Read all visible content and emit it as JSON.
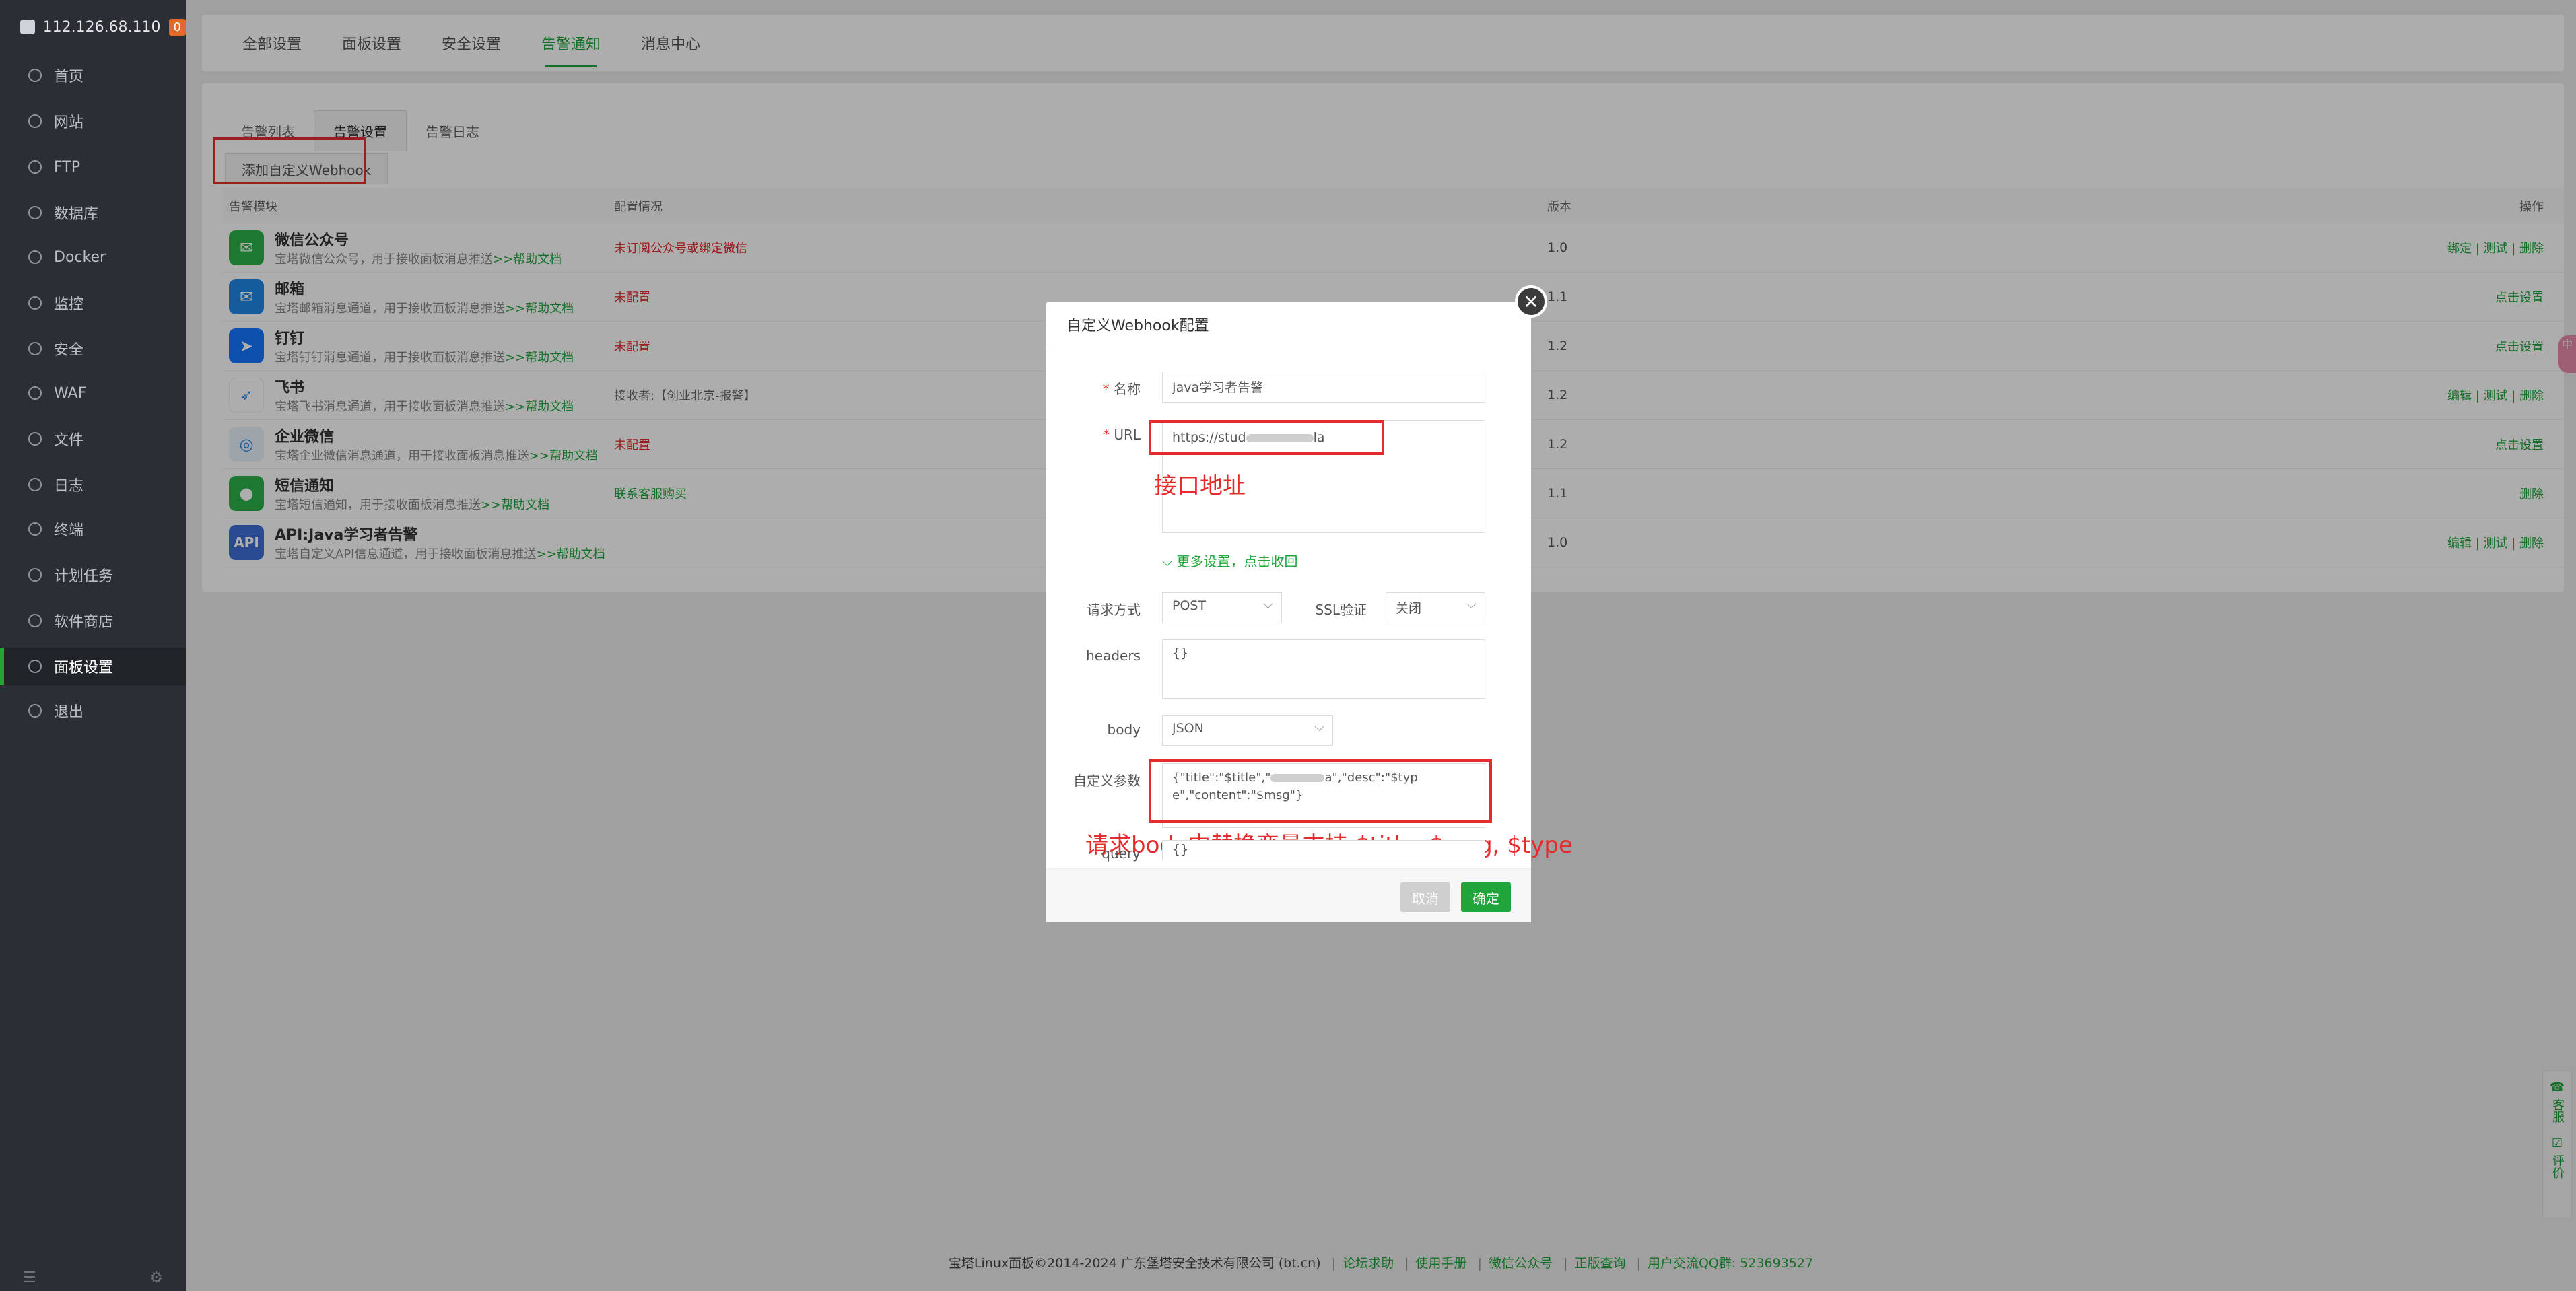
{
  "sidebar": {
    "ip": "112.126.68.110",
    "badge": "0",
    "items": [
      {
        "label": "首页"
      },
      {
        "label": "网站"
      },
      {
        "label": "FTP"
      },
      {
        "label": "数据库"
      },
      {
        "label": "Docker"
      },
      {
        "label": "监控"
      },
      {
        "label": "安全"
      },
      {
        "label": "WAF"
      },
      {
        "label": "文件"
      },
      {
        "label": "日志"
      },
      {
        "label": "终端"
      },
      {
        "label": "计划任务"
      },
      {
        "label": "软件商店"
      },
      {
        "label": "面板设置"
      },
      {
        "label": "退出"
      }
    ]
  },
  "top_tabs": [
    "全部设置",
    "面板设置",
    "安全设置",
    "告警通知",
    "消息中心"
  ],
  "sub_tabs": [
    "告警列表",
    "告警设置",
    "告警日志"
  ],
  "webhook_button": "添加自定义Webhook",
  "table": {
    "headers": [
      "告警模块",
      "配置情况",
      "版本",
      "操作"
    ],
    "rows": [
      {
        "name": "微信公众号",
        "desc": "宝塔微信公众号，用于接收面板消息推送",
        "help": ">>帮助文档",
        "status": "未订阅公众号或绑定微信",
        "version": "1.0",
        "action": "绑定 | 测试 | 删除"
      },
      {
        "name": "邮箱",
        "desc": "宝塔邮箱消息通道，用于接收面板消息推送",
        "help": ">>帮助文档",
        "status": "未配置",
        "version": "1.1",
        "action": "点击设置"
      },
      {
        "name": "钉钉",
        "desc": "宝塔钉钉消息通道，用于接收面板消息推送",
        "help": ">>帮助文档",
        "status": "未配置",
        "version": "1.2",
        "action": "点击设置"
      },
      {
        "name": "飞书",
        "desc": "宝塔飞书消息通道，用于接收面板消息推送",
        "help": ">>帮助文档",
        "status": "接收者:【创业北京-报警】",
        "version": "1.2",
        "action": "编辑 | 测试 | 删除"
      },
      {
        "name": "企业微信",
        "desc": "宝塔企业微信消息通道，用于接收面板消息推送",
        "help": ">>帮助文档",
        "status": "未配置",
        "version": "1.2",
        "action": "点击设置"
      },
      {
        "name": "短信通知",
        "desc": "宝塔短信通知，用于接收面板消息推送",
        "help": ">>帮助文档",
        "status": "联系客服购买",
        "version": "1.1",
        "action": "删除"
      },
      {
        "name": "API:Java学习者告警",
        "desc": "宝塔自定义API信息通道，用于接收面板消息推送",
        "help": ">>帮助文档",
        "status": "",
        "version": "1.0",
        "action": "编辑 | 测试 | 删除"
      }
    ]
  },
  "modal": {
    "title": "自定义Webhook配置",
    "name_label": "名称",
    "name_value": "Java学习者告警",
    "url_label": "URL",
    "url_value": "https://stud",
    "url_suffix": "la",
    "url_annotation": "接口地址",
    "more_settings": "更多设置，点击收回",
    "method_label": "请求方式",
    "method_value": "POST",
    "ssl_label": "SSL验证",
    "ssl_value": "关闭",
    "headers_label": "headers",
    "headers_value": "{}",
    "body_label": "body",
    "body_value": "JSON",
    "params_label": "自定义参数",
    "params_line1_a": "{\"title\":\"$title\",\"",
    "params_line1_b": "a\",\"desc\":\"$typ",
    "params_line2": "e\",\"content\":\"$msg\"}",
    "params_annotation": "请求body中替换变量支持 $title, $msg, $type",
    "query_label": "query",
    "query_value": "{}",
    "cancel": "取消",
    "confirm": "确定"
  },
  "footer": {
    "copyright": "宝塔Linux面板©2014-2024 广东堡塔安全技术有限公司 (bt.cn)",
    "links": [
      "论坛求助",
      "使用手册",
      "微信公众号",
      "正版查询",
      "用户交流QQ群: 523693527"
    ]
  },
  "right_float": {
    "top_tab": "中",
    "service": "客服",
    "rate": "评价"
  }
}
